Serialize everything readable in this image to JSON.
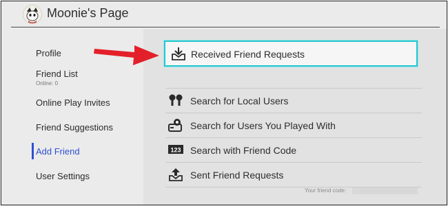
{
  "header": {
    "title": "Moonie's Page"
  },
  "sidebar": {
    "items": [
      {
        "label": "Profile"
      },
      {
        "label": "Friend List",
        "sub": "Online: 0"
      },
      {
        "label": "Online Play Invites"
      },
      {
        "label": "Friend Suggestions"
      },
      {
        "label": "Add Friend"
      },
      {
        "label": "User Settings"
      }
    ]
  },
  "main": {
    "selected": {
      "label": "Received Friend Requests",
      "icon": "inbox-download-icon"
    },
    "items": [
      {
        "label": "Search for Local Users",
        "icon": "local-users-icon"
      },
      {
        "label": "Search for Users You Played With",
        "icon": "played-with-icon"
      },
      {
        "label": "Search with Friend Code",
        "icon": "friend-code-123-icon"
      },
      {
        "label": "Sent Friend Requests",
        "icon": "sent-upload-icon"
      }
    ],
    "friend_code_label": "Your friend code:"
  },
  "colors": {
    "accent": "#2f4fd0",
    "selection": "#26c6cf",
    "arrow": "#e3202a"
  }
}
